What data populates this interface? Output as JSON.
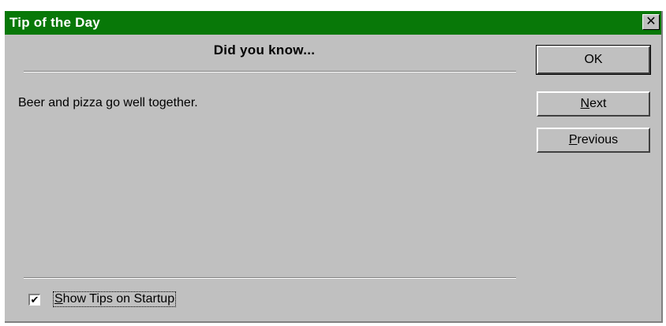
{
  "window": {
    "title": "Tip of the Day",
    "close_glyph": "✕"
  },
  "dialog": {
    "heading": "Did you know...",
    "tip_text": "Beer and pizza go well together."
  },
  "buttons": {
    "ok_label": "OK",
    "next_label_mnemonic": "N",
    "next_label_rest": "ext",
    "previous_label_mnemonic": "P",
    "previous_label_rest": "revious"
  },
  "startup_checkbox": {
    "checked": true,
    "check_glyph": "✔",
    "label_mnemonic": "S",
    "label_rest": "how Tips on Startup"
  },
  "colors": {
    "titlebar": "#087808",
    "face": "#c0c0c0"
  },
  "icons": {
    "close": "close-icon",
    "check": "checkmark-icon"
  }
}
